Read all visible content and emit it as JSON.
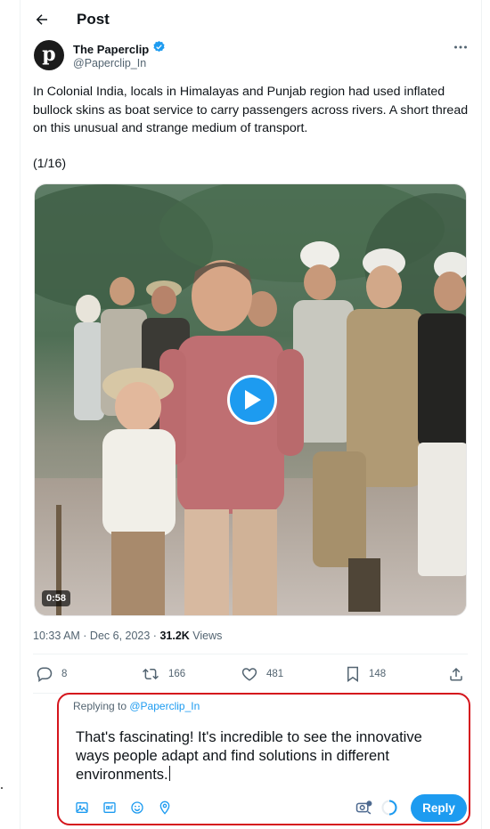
{
  "header": {
    "title": "Post"
  },
  "author": {
    "name": "The Paperclip",
    "handle": "@Paperclip_In",
    "avatar_letter": "p",
    "verified": true
  },
  "tweet": {
    "text": "In Colonial India, locals in Himalayas and Punjab region had used inflated bullock skins as boat service to carry passengers across rivers. A short thread on this unusual and strange medium of transport.",
    "thread_count": "(1/16)",
    "video_duration": "0:58",
    "time": "10:33 AM · Dec 6, 2023 · ",
    "views_count": "31.2K",
    "views_label": " Views"
  },
  "actions": {
    "replies": "8",
    "reposts": "166",
    "likes": "481",
    "bookmarks": "148"
  },
  "reply_composer": {
    "replying_to_label": "Replying to ",
    "replying_to_handle": "@Paperclip_In",
    "text": "That's fascinating! It's incredible to see the innovative ways people adapt and find solutions in different environments.",
    "reply_button": "Reply"
  },
  "colors": {
    "accent": "#1d9bf0",
    "highlight_border": "#d5151c",
    "muted_text": "#536471"
  },
  "icons": [
    "back-arrow-icon",
    "verified-badge-icon",
    "more-icon",
    "play-icon",
    "reply-icon",
    "repost-icon",
    "like-icon",
    "bookmark-icon",
    "share-icon",
    "image-icon",
    "gif-icon",
    "emoji-icon",
    "location-icon",
    "grammar-icon",
    "progress-ring-icon"
  ]
}
